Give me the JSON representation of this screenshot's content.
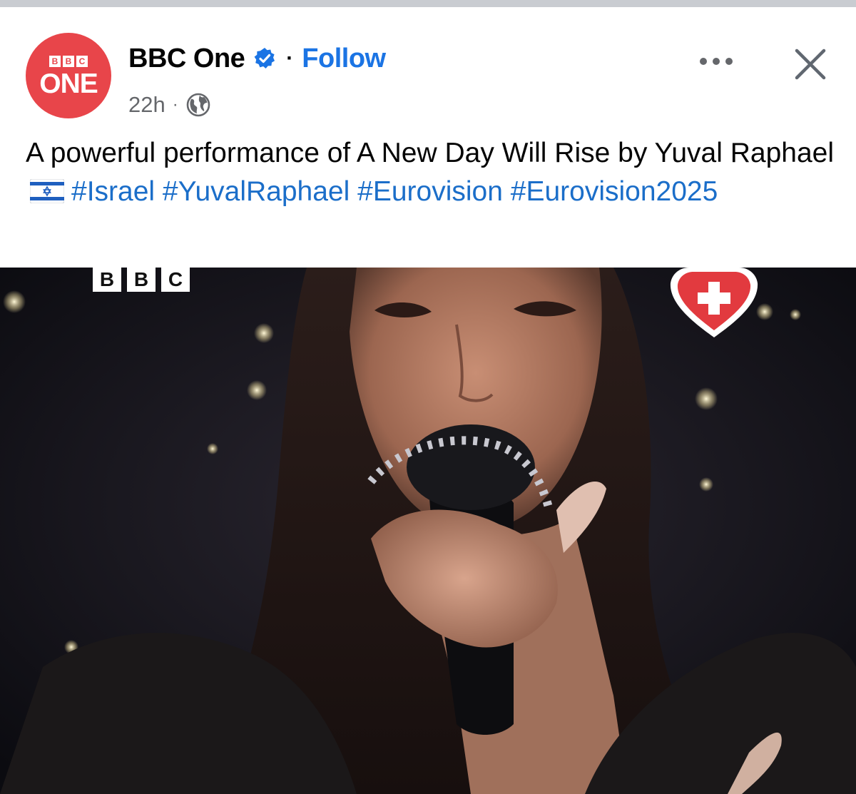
{
  "post": {
    "page_name": "BBC One",
    "follow_label": "Follow",
    "separator": "·",
    "timestamp": "22h",
    "meta_separator": "·",
    "avatar": {
      "top_text": [
        "B",
        "B",
        "C"
      ],
      "main_text": "ONE",
      "color": "#e8454a"
    },
    "caption": {
      "text_part1": "A powerful performance of A New Day Will Rise by Yuval Raphael",
      "hashtags": [
        "#Israel",
        "#YuvalRaphael",
        "#Eurovision",
        "#Eurovision2025"
      ]
    },
    "icons": {
      "verified": "verified-badge-icon",
      "audience": "globe-icon",
      "more": "more-options-icon",
      "close": "close-icon",
      "flag": "israel-flag-icon"
    }
  },
  "video": {
    "watermark": [
      "B",
      "B",
      "C"
    ],
    "badge": "swiss-heart-badge"
  },
  "colors": {
    "link_blue": "#1b74e4",
    "hashtag_blue": "#1b6ec9",
    "text_primary": "#050505",
    "text_secondary": "#65676b",
    "bbc_red": "#e8454a"
  }
}
